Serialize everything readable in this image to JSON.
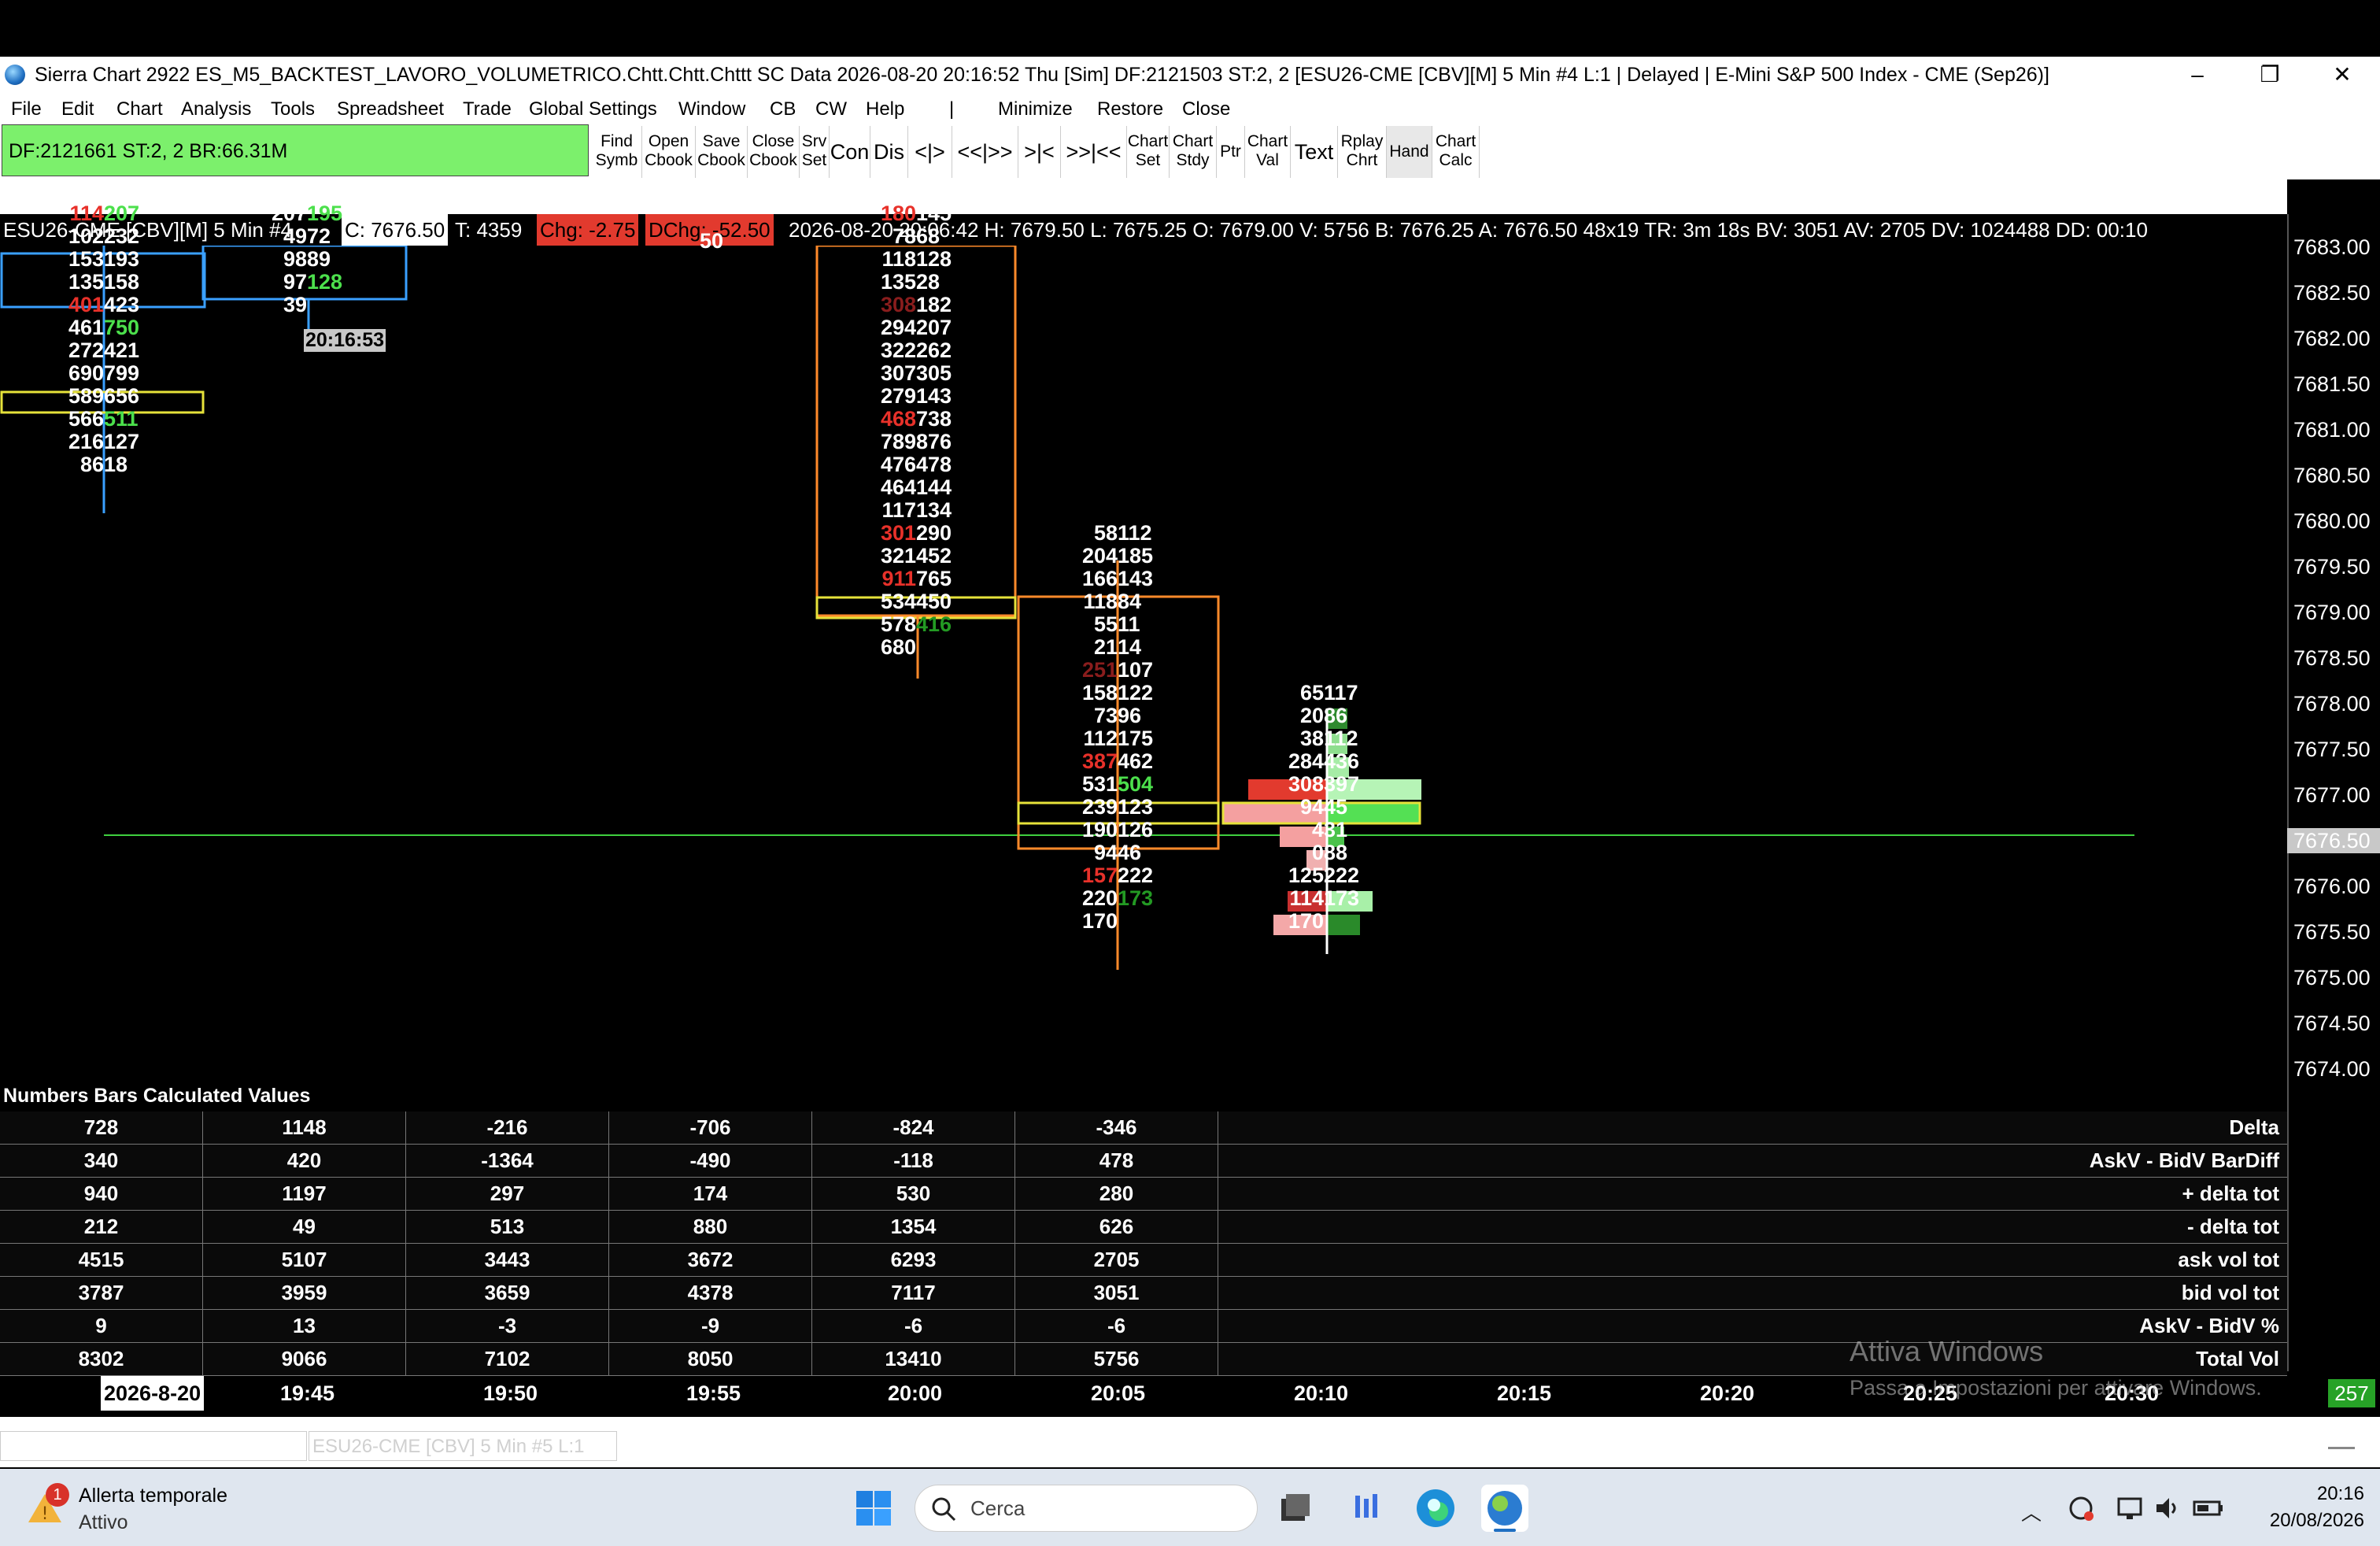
{
  "window": {
    "title": "Sierra Chart 2922 ES_M5_BACKTEST_LAVORO_VOLUMETRICO.Chtt.Chtt.Chttt SC Data 2026-08-20  20:16:52 Thu [Sim] DF:2121503  ST:2, 2 [ESU26-CME [CBV][M]  5 Min  #4 L:1 | Delayed | E-Mini S&P 500 Index - CME (Sep26)]",
    "minimize_icon": "–",
    "restore_icon": "❐",
    "close_icon": "✕"
  },
  "menu": {
    "items": [
      "File",
      "Edit",
      "Chart",
      "Analysis",
      "Tools",
      "Spreadsheet",
      "Trade",
      "Global Settings",
      "Window",
      "CB",
      "CW",
      "Help",
      "|",
      "Minimize",
      "Restore",
      "Close"
    ]
  },
  "toolbar": {
    "status": "DF:2121661  ST:2, 2   BR:66.31M",
    "buttons": [
      {
        "l1": "Find",
        "l2": "Symb"
      },
      {
        "l1": "Open",
        "l2": "Cbook"
      },
      {
        "l1": "Save",
        "l2": "Cbook"
      },
      {
        "l1": "Close",
        "l2": "Cbook"
      },
      {
        "l1": "Srv",
        "l2": "Set"
      }
    ],
    "big_buttons": [
      "Con",
      "Dis",
      "<|>",
      "<<|>>",
      ">|<",
      ">>|<<"
    ],
    "buttons2": [
      {
        "l1": "Chart",
        "l2": "Set"
      },
      {
        "l1": "Chart",
        "l2": "Stdy"
      },
      {
        "l1": "Ptr",
        "l2": ""
      },
      {
        "l1": "Chart",
        "l2": "Val"
      }
    ],
    "text_btn": "Text",
    "rplay": {
      "l1": "Rplay",
      "l2": "Chrt"
    },
    "hand": "Hand",
    "calc": {
      "l1": "Chart",
      "l2": "Calc"
    }
  },
  "infobar": {
    "symbol": "ESU26-CME [CBV][M]   5 Min   #4",
    "close": "C: 7676.50",
    "trades": "T: 4359",
    "chg": "Chg: -2.75",
    "dchg": "DChg: -52.50",
    "rest": "2026-08-20 20:06:42  H: 7679.50  L: 7675.25  O: 7679.00  V: 5756  B: 7676.25  A: 7676.50  48x19  TR: 3m 18s  BV: 3051  AV: 2705  DV: 1024488  DD: 00:10"
  },
  "price_axis": {
    "labels": [
      "7683.00",
      "7682.50",
      "7682.00",
      "7681.50",
      "7681.00",
      "7680.50",
      "7680.00",
      "7679.50",
      "7679.00",
      "7678.50",
      "7678.00",
      "7677.50",
      "7677.00",
      "7676.50",
      "7676.00",
      "7675.50",
      "7675.00",
      "7674.50",
      "7674.00"
    ],
    "current": "7676.50"
  },
  "footprint": {
    "bar1": [
      [
        "114",
        "207"
      ],
      [
        "102",
        "232"
      ],
      [
        "153",
        "193"
      ],
      [
        "135",
        "158"
      ],
      [
        "401",
        "423"
      ],
      [
        "461",
        "750"
      ],
      [
        "272",
        "421"
      ],
      [
        "690",
        "799"
      ],
      [
        "589",
        "656"
      ],
      [
        "566",
        "511"
      ],
      [
        "216",
        "127"
      ],
      [
        "86",
        "18"
      ]
    ],
    "bar2": [
      [
        "207",
        "195"
      ],
      [
        "49",
        "72"
      ],
      [
        "98",
        "89"
      ],
      [
        "97",
        "128"
      ],
      [
        "39",
        ""
      ]
    ],
    "bar2_time": "20:16:53",
    "bar3_top": "50",
    "bar4": [
      [
        "180",
        "145"
      ],
      [
        "78",
        "68"
      ],
      [
        "118",
        "128"
      ],
      [
        "135",
        "28"
      ],
      [
        "308",
        "182"
      ],
      [
        "294",
        "207"
      ],
      [
        "322",
        "262"
      ],
      [
        "307",
        "305"
      ],
      [
        "279",
        "143"
      ],
      [
        "468",
        "738"
      ],
      [
        "789",
        "876"
      ],
      [
        "476",
        "478"
      ],
      [
        "464",
        "144"
      ],
      [
        "117",
        "134"
      ],
      [
        "301",
        "290"
      ],
      [
        "321",
        "452"
      ],
      [
        "911",
        "765"
      ],
      [
        "534",
        "450"
      ],
      [
        "578",
        "416"
      ],
      [
        "680",
        ""
      ]
    ],
    "bar5": [
      [
        "58",
        "112"
      ],
      [
        "204",
        "185"
      ],
      [
        "166",
        "143"
      ],
      [
        "118",
        "84"
      ],
      [
        "55",
        "11"
      ],
      [
        "21",
        "14"
      ],
      [
        "251",
        "107"
      ],
      [
        "158",
        "122"
      ],
      [
        "73",
        "96"
      ],
      [
        "112",
        "175"
      ],
      [
        "387",
        "462"
      ],
      [
        "531",
        "504"
      ],
      [
        "239",
        "123"
      ],
      [
        "190",
        "126"
      ],
      [
        "94",
        "46"
      ],
      [
        "157",
        "222"
      ],
      [
        "220",
        "173"
      ],
      [
        "170",
        ""
      ]
    ],
    "bar6": [
      [
        "65",
        "117"
      ],
      [
        "20",
        "86"
      ],
      [
        "38",
        "112"
      ],
      [
        "284",
        "436"
      ],
      [
        "308",
        "397"
      ],
      [
        "94",
        "45"
      ],
      [
        "4",
        "31"
      ],
      [
        "0",
        "88"
      ],
      [
        "125",
        "222"
      ],
      [
        "114",
        "173"
      ],
      [
        "170",
        ""
      ]
    ]
  },
  "stats": {
    "title": "Numbers Bars Calculated Values",
    "rows": [
      {
        "label": "Delta",
        "values": [
          "728",
          "1148",
          "-216",
          "-706",
          "-824",
          "-346"
        ]
      },
      {
        "label": "AskV - BidV BarDiff",
        "values": [
          "340",
          "420",
          "-1364",
          "-490",
          "-118",
          "478"
        ]
      },
      {
        "label": "+ delta tot",
        "values": [
          "940",
          "1197",
          "297",
          "174",
          "530",
          "280"
        ]
      },
      {
        "label": "- delta tot",
        "values": [
          "212",
          "49",
          "513",
          "880",
          "1354",
          "626"
        ]
      },
      {
        "label": "ask vol tot",
        "values": [
          "4515",
          "5107",
          "3443",
          "3672",
          "6293",
          "2705"
        ]
      },
      {
        "label": "bid vol tot",
        "values": [
          "3787",
          "3959",
          "3659",
          "4378",
          "7117",
          "3051"
        ]
      },
      {
        "label": "AskV - BidV %",
        "values": [
          "9",
          "13",
          "-3",
          "-9",
          "-6",
          "-6"
        ]
      },
      {
        "label": "Total Vol",
        "values": [
          "8302",
          "9066",
          "7102",
          "8050",
          "13410",
          "5756"
        ]
      }
    ]
  },
  "time_axis": {
    "labels": [
      "2026-8-20",
      "19:45",
      "19:50",
      "19:55",
      "20:00",
      "20:05",
      "20:10",
      "20:15",
      "20:20",
      "20:25",
      "20:30"
    ],
    "counter": "257"
  },
  "watermark": {
    "l1": "Attiva Windows",
    "l2": "Passa a Impostazioni per attivare Windows."
  },
  "tabbar": {
    "tab": "ESU26-CME [CBV]  5 Min  #5 L:1"
  },
  "taskbar": {
    "weather_title": "Allerta temporale",
    "weather_sub": "Attivo",
    "weather_badge": "1",
    "search": "Cerca",
    "time": "20:16",
    "date": "20/08/2026"
  }
}
